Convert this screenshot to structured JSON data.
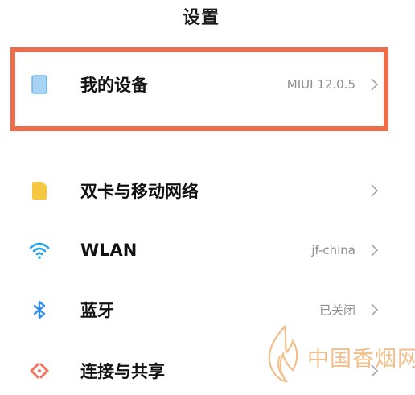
{
  "header": {
    "title": "设置"
  },
  "settings": {
    "my_device": {
      "label": "我的设备",
      "value": "MIUI 12.0.5",
      "icon": "tablet-icon",
      "icon_color": "#a8d3f3"
    },
    "dual_sim": {
      "label": "双卡与移动网络",
      "value": "",
      "icon": "sim-card-icon",
      "icon_color": "#f5c842"
    },
    "wlan": {
      "label": "WLAN",
      "value": "jf-china",
      "icon": "wifi-icon",
      "icon_color": "#2aa4ea"
    },
    "bluetooth": {
      "label": "蓝牙",
      "value": "已关闭",
      "icon": "bluetooth-icon",
      "icon_color": "#2f8cea"
    },
    "connection_sharing": {
      "label": "连接与共享",
      "value": "",
      "icon": "share-connection-icon",
      "icon_color": "#f0745f"
    }
  },
  "highlight_color": "#ef6c4b",
  "watermark": {
    "text": "中国香烟网",
    "color": "#e98a2a"
  }
}
